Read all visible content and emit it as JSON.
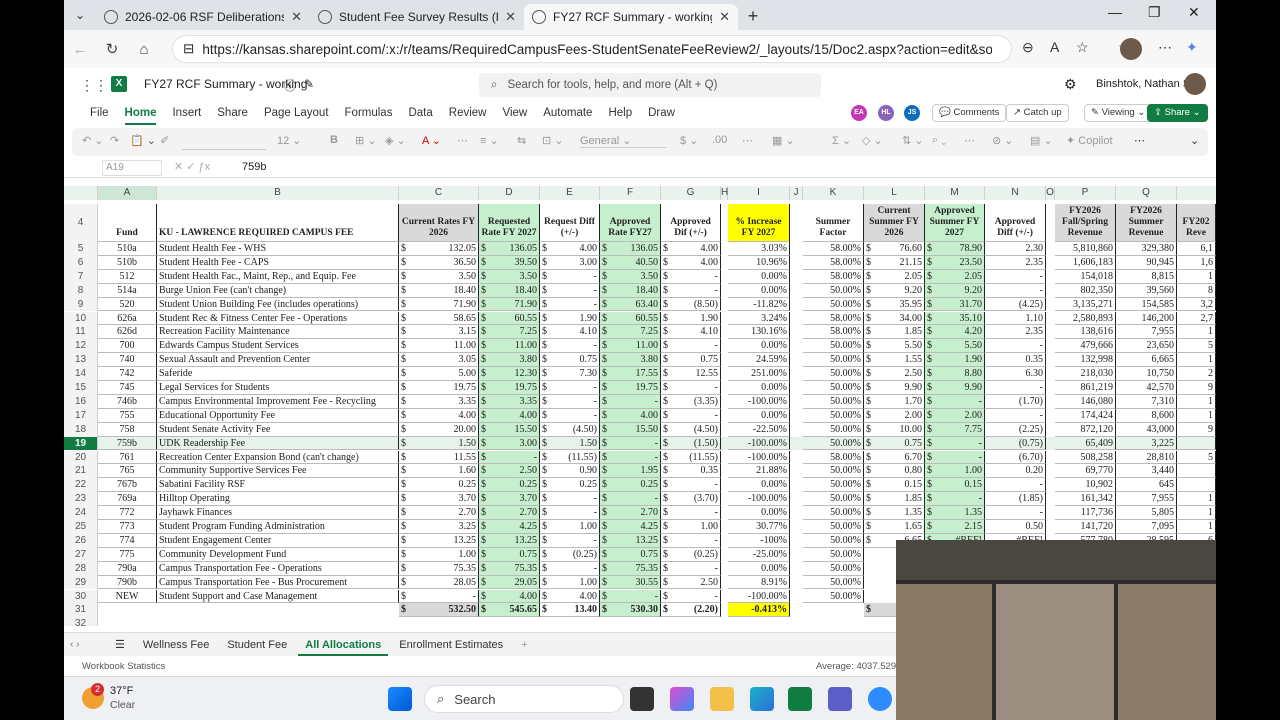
{
  "browser": {
    "tabs": [
      {
        "label": "2026-02-06 RSF Deliberations Ag"
      },
      {
        "label": "Student Fee Survey Results (FY27)"
      },
      {
        "label": "FY27 RCF Summary - working.xlsx"
      }
    ],
    "url": "https://kansas.sharepoint.com/:x:/r/teams/RequiredCampusFees-StudentSenateFeeReview2/_layouts/15/Doc2.aspx?action=edit&sourcedoc..."
  },
  "app": {
    "doc_title": "FY27 RCF Summary - working",
    "search_placeholder": "Search for tools, help, and more (Alt + Q)",
    "user": "Binshtok, Nathan S",
    "collaborators": [
      {
        "initials": "EA",
        "color": "#c239b3"
      },
      {
        "initials": "HL",
        "color": "#8764b8"
      },
      {
        "initials": "JS",
        "color": "#0f6cbd"
      }
    ],
    "comments": "Comments",
    "catchup": "Catch up",
    "viewing": "Viewing",
    "share": "Share"
  },
  "menu": [
    "File",
    "Home",
    "Insert",
    "Share",
    "Page Layout",
    "Formulas",
    "Data",
    "Review",
    "View",
    "Automate",
    "Help",
    "Draw"
  ],
  "ribbon": {
    "font_size": "12",
    "number_format": "General",
    "copilot": "Copilot"
  },
  "formula": {
    "cell": "A19",
    "value": "759b"
  },
  "columns": [
    "A",
    "B",
    "C",
    "D",
    "E",
    "F",
    "G",
    "H",
    "I",
    "J",
    "K",
    "L",
    "M",
    "N",
    "O",
    "P",
    "Q"
  ],
  "headers": {
    "fund": "Fund",
    "name": "KU - LAWRENCE REQUIRED CAMPUS FEE",
    "cur": "Current Rates FY 2026",
    "req": "Requested Rate FY 2027",
    "rdiff": "Request Diff (+/-)",
    "appr": "Approved Rate FY27",
    "adiff": "Approved Dif (+/-)",
    "pct": "% Increase FY 2027",
    "sf": "Summer Factor",
    "csum": "Current Summer FY 2026",
    "asum": "Approved Summer FY 2027",
    "asdiff": "Approved Diff (+/-)",
    "fsrev": "FY2026 Fall/Spring Revenue",
    "srev": "FY2026 Summer Revenue",
    "r": "FY202 Reve"
  },
  "rows": [
    [
      "5",
      "510a",
      "Student Health Fee - WHS",
      "132.05",
      "136.05",
      "4.00",
      "136.05",
      "4.00",
      "3.03%",
      "58.00%",
      "76.60",
      "78.90",
      "2.30",
      "5,810,860",
      "329,380",
      "6,1"
    ],
    [
      "6",
      "510b",
      "Student Health Fee - CAPS",
      "36.50",
      "39.50",
      "3.00",
      "40.50",
      "4.00",
      "10.96%",
      "58.00%",
      "21.15",
      "23.50",
      "2.35",
      "1,606,183",
      "90,945",
      "1,6"
    ],
    [
      "7",
      "512",
      "Student Health Fac., Maint, Rep., and Equip. Fee",
      "3.50",
      "3.50",
      "-",
      "3.50",
      "-",
      "0.00%",
      "58.00%",
      "2.05",
      "2.05",
      "-",
      "154,018",
      "8,815",
      "1"
    ],
    [
      "8",
      "514a",
      "Burge Union Fee (can't change)",
      "18.40",
      "18.40",
      "-",
      "18.40",
      "-",
      "0.00%",
      "50.00%",
      "9.20",
      "9.20",
      "-",
      "802,350",
      "39,560",
      "8"
    ],
    [
      "9",
      "520",
      "Student Union Building Fee (includes operations)",
      "71.90",
      "71.90",
      "-",
      "63.40",
      "(8.50)",
      "-11.82%",
      "50.00%",
      "35.95",
      "31.70",
      "(4.25)",
      "3,135,271",
      "154,585",
      "3,2"
    ],
    [
      "10",
      "626a",
      "Student Rec & Fitness Center Fee - Operations",
      "58.65",
      "60.55",
      "1.90",
      "60.55",
      "1.90",
      "3.24%",
      "58.00%",
      "34.00",
      "35.10",
      "1.10",
      "2,580,893",
      "146,200",
      "2,7"
    ],
    [
      "11",
      "626d",
      "Recreation Facility Maintenance",
      "3.15",
      "7.25",
      "4.10",
      "7.25",
      "4.10",
      "130.16%",
      "58.00%",
      "1.85",
      "4.20",
      "2.35",
      "138,616",
      "7,955",
      "1"
    ],
    [
      "12",
      "700",
      "Edwards Campus Student Services",
      "11.00",
      "11.00",
      "-",
      "11.00",
      "-",
      "0.00%",
      "50.00%",
      "5.50",
      "5.50",
      "-",
      "479,666",
      "23,650",
      "5"
    ],
    [
      "13",
      "740",
      "Sexual Assault and Prevention Center",
      "3.05",
      "3.80",
      "0.75",
      "3.80",
      "0.75",
      "24.59%",
      "50.00%",
      "1.55",
      "1.90",
      "0.35",
      "132,998",
      "6,665",
      "1"
    ],
    [
      "14",
      "742",
      "Saferide",
      "5.00",
      "12.30",
      "7.30",
      "17.55",
      "12.55",
      "251.00%",
      "50.00%",
      "2.50",
      "8.80",
      "6.30",
      "218,030",
      "10,750",
      "2"
    ],
    [
      "15",
      "745",
      "Legal Services for Students",
      "19.75",
      "19.75",
      "-",
      "19.75",
      "-",
      "0.00%",
      "50.00%",
      "9.90",
      "9.90",
      "-",
      "861,219",
      "42,570",
      "9"
    ],
    [
      "16",
      "746b",
      "Campus Environmental Improvement Fee - Recycling",
      "3.35",
      "3.35",
      "-",
      "-",
      "(3.35)",
      "-100.00%",
      "50.00%",
      "1.70",
      "-",
      "(1.70)",
      "146,080",
      "7,310",
      "1"
    ],
    [
      "17",
      "755",
      "Educational Opportunity Fee",
      "4.00",
      "4.00",
      "-",
      "4.00",
      "-",
      "0.00%",
      "50.00%",
      "2.00",
      "2.00",
      "-",
      "174,424",
      "8,600",
      "1"
    ],
    [
      "18",
      "758",
      "Student Senate Activity Fee",
      "20.00",
      "15.50",
      "(4.50)",
      "15.50",
      "(4.50)",
      "-22.50%",
      "50.00%",
      "10.00",
      "7.75",
      "(2.25)",
      "872,120",
      "43,000",
      "9"
    ],
    [
      "19",
      "759b",
      "UDK Readership Fee",
      "1.50",
      "3.00",
      "1.50",
      "-",
      "(1.50)",
      "-100.00%",
      "50.00%",
      "0.75",
      "-",
      "(0.75)",
      "65,409",
      "3,225",
      ""
    ],
    [
      "20",
      "761",
      "Recreation Center Expansion Bond (can't change)",
      "11.55",
      "-",
      "(11.55)",
      "-",
      "(11.55)",
      "-100.00%",
      "58.00%",
      "6.70",
      "-",
      "(6.70)",
      "508,258",
      "28,810",
      "5"
    ],
    [
      "21",
      "765",
      "Community Supportive Services Fee",
      "1.60",
      "2.50",
      "0.90",
      "1.95",
      "0.35",
      "21.88%",
      "50.00%",
      "0.80",
      "1.00",
      "0.20",
      "69,770",
      "3,440",
      ""
    ],
    [
      "22",
      "767b",
      "Sabatini Facility RSF",
      "0.25",
      "0.25",
      "0.25",
      "0.25",
      "-",
      "0.00%",
      "50.00%",
      "0.15",
      "0.15",
      "-",
      "10,902",
      "645",
      ""
    ],
    [
      "23",
      "769a",
      "Hilltop Operating",
      "3.70",
      "3.70",
      "-",
      "-",
      "(3.70)",
      "-100.00%",
      "50.00%",
      "1.85",
      "-",
      "(1.85)",
      "161,342",
      "7,955",
      "1"
    ],
    [
      "24",
      "772",
      "Jayhawk Finances",
      "2.70",
      "2.70",
      "-",
      "2.70",
      "-",
      "0.00%",
      "50.00%",
      "1.35",
      "1.35",
      "-",
      "117,736",
      "5,805",
      "1"
    ],
    [
      "25",
      "773",
      "Student Program Funding Administration",
      "3.25",
      "4.25",
      "1.00",
      "4.25",
      "1.00",
      "30.77%",
      "50.00%",
      "1.65",
      "2.15",
      "0.50",
      "141,720",
      "7,095",
      "1"
    ],
    [
      "26",
      "774",
      "Student Engagement Center",
      "13.25",
      "13.25",
      "-",
      "13.25",
      "-",
      "-100%",
      "50.00%",
      "6.65",
      "#REF!",
      "#REF!",
      "577,780",
      "28,595",
      "6"
    ],
    [
      "27",
      "775",
      "Community Development Fund",
      "1.00",
      "0.75",
      "(0.25)",
      "0.75",
      "(0.25)",
      "-25.00%",
      "50.00%",
      "",
      "",
      "",
      "",
      "",
      ""
    ],
    [
      "28",
      "790a",
      "Campus Transportation Fee - Operations",
      "75.35",
      "75.35",
      "-",
      "75.35",
      "-",
      "0.00%",
      "50.00%",
      "",
      "",
      "",
      "",
      "",
      ""
    ],
    [
      "29",
      "790b",
      "Campus Transportation Fee - Bus Procurement",
      "28.05",
      "29.05",
      "1.00",
      "30.55",
      "2.50",
      "8.91%",
      "50.00%",
      "",
      "",
      "",
      "",
      "",
      ""
    ],
    [
      "30",
      "NEW",
      "Student Support and Case Management",
      "-",
      "4.00",
      "4.00",
      "-",
      "-",
      "-100.00%",
      "50.00%",
      "",
      "",
      "",
      "",
      "",
      ""
    ]
  ],
  "total": {
    "row": "31",
    "cur": "532.50",
    "req": "545.65",
    "rdiff": "13.40",
    "appr": "530.30",
    "adiff": "(2.20)",
    "pct": "-0.413%",
    "l": "28"
  },
  "sheets": [
    "Wellness Fee",
    "Student Fee",
    "All Allocations",
    "Enrollment Estimates"
  ],
  "active_sheet": "All Allocations",
  "status": {
    "left": "Workbook Statistics",
    "right": "Average: 4037.52941"
  },
  "taskbar": {
    "temp": "37°F",
    "weather": "Clear",
    "search": "Search",
    "badge": "2"
  }
}
